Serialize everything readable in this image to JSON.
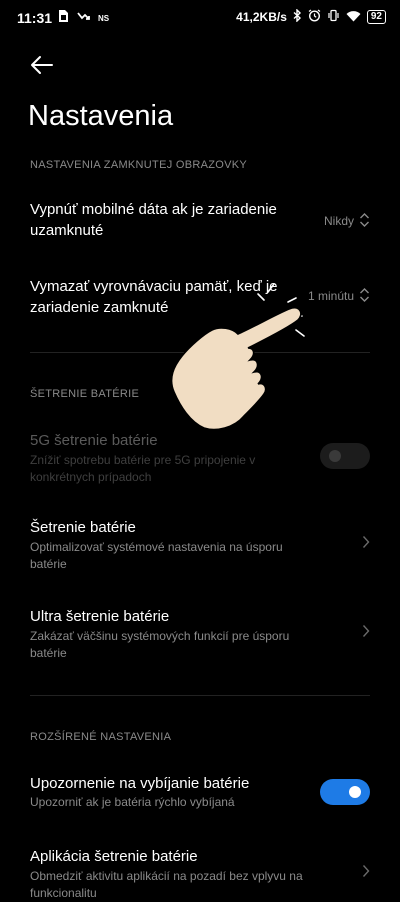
{
  "status_bar": {
    "time": "11:31",
    "left_icons": [
      "sim-icon",
      "missed-call-icon",
      "ns-label"
    ],
    "ns_label": "NS",
    "speed": "41,2KB/s",
    "right_icons": [
      "bluetooth-icon",
      "alarm-icon",
      "vibrate-icon",
      "wifi-icon"
    ],
    "battery": "92"
  },
  "header": {
    "title": "Nastavenia"
  },
  "sections": {
    "lock_screen": {
      "header": "NASTAVENIA ZAMKNUTEJ OBRAZOVKY",
      "mobile_data": {
        "title_line1": "Vypnúť mobilné dáta ak je zariadenie",
        "title_line2": "uzamknuté",
        "value": "Nikdy"
      },
      "clear_cache": {
        "title_line1": "Vymazať vyrovnávaciu pamäť, keď je",
        "title_line2": "zariadenie zamknuté",
        "value": "1 minútu"
      }
    },
    "battery_saver": {
      "header": "ŠETRENIE BATÉRIE",
      "saver_5g": {
        "title": "5G šetrenie batérie",
        "sub_line1": "Znížiť spotrebu batérie pre 5G pripojenie v",
        "sub_line2": "konkrétnych prípadoch",
        "enabled": false,
        "disabled": true
      },
      "saver": {
        "title": "Šetrenie batérie",
        "sub_line1": "Optimalizovať systémové nastavenia na úsporu",
        "sub_line2": "batérie"
      },
      "ultra": {
        "title": "Ultra šetrenie batérie",
        "sub_line1": "Zakázať väčšinu systémových funkcií pre úsporu",
        "sub_line2": "batérie"
      }
    },
    "advanced": {
      "header": "ROZŠÍRENÉ NASTAVENIA",
      "drain_alert": {
        "title": "Upozornenie na vybíjanie batérie",
        "sub": "Upozorniť ak je batéria rýchlo vybíjaná",
        "enabled": true
      },
      "app_saver": {
        "title": "Aplikácia šetrenie batérie",
        "sub_line1": "Obmedziť aktivitu aplikácií na pozadí bez vplyvu na",
        "sub_line2": "funkcionalitu"
      }
    }
  },
  "colors": {
    "background": "#000000",
    "toggle_on": "#1e7be6",
    "toggle_off": "#2a2a2a",
    "secondary_text": "#8a8a8a",
    "hand_fill": "#f1ddc3"
  }
}
